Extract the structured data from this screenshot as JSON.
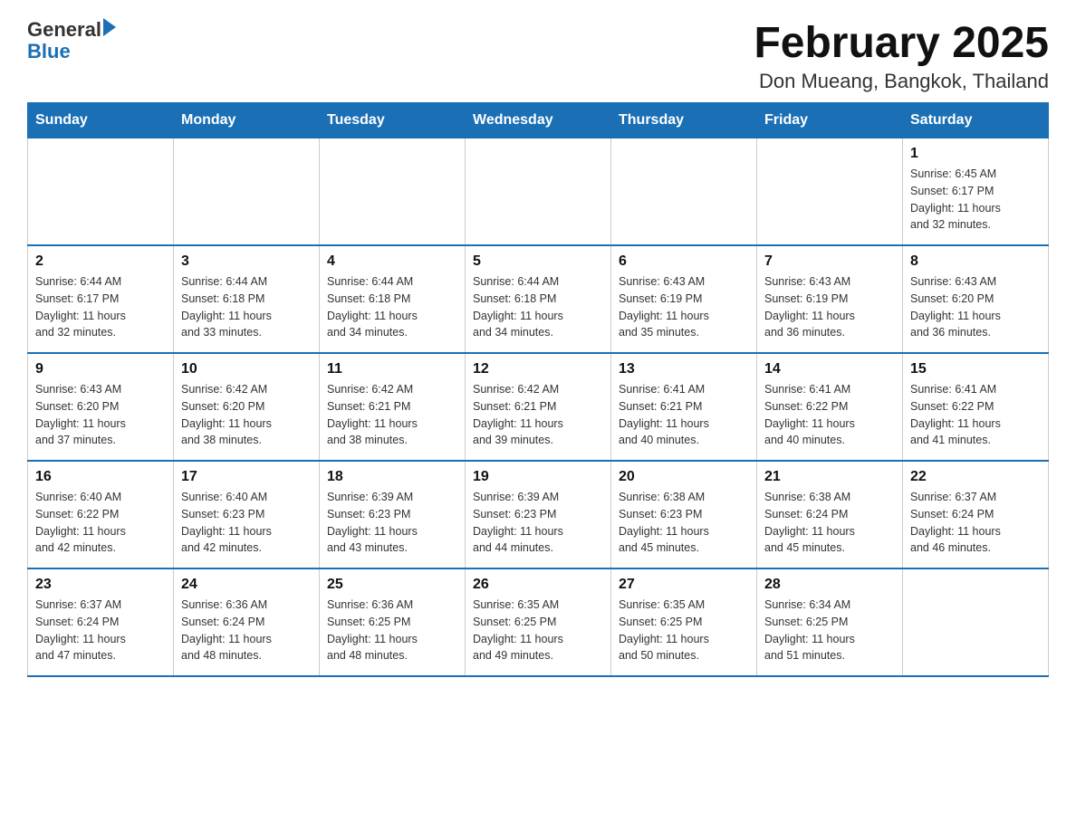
{
  "header": {
    "logo_general": "General",
    "logo_blue": "Blue",
    "month_title": "February 2025",
    "location": "Don Mueang, Bangkok, Thailand"
  },
  "days_of_week": [
    "Sunday",
    "Monday",
    "Tuesday",
    "Wednesday",
    "Thursday",
    "Friday",
    "Saturday"
  ],
  "weeks": [
    {
      "days": [
        {
          "number": "",
          "info": ""
        },
        {
          "number": "",
          "info": ""
        },
        {
          "number": "",
          "info": ""
        },
        {
          "number": "",
          "info": ""
        },
        {
          "number": "",
          "info": ""
        },
        {
          "number": "",
          "info": ""
        },
        {
          "number": "1",
          "info": "Sunrise: 6:45 AM\nSunset: 6:17 PM\nDaylight: 11 hours\nand 32 minutes."
        }
      ]
    },
    {
      "days": [
        {
          "number": "2",
          "info": "Sunrise: 6:44 AM\nSunset: 6:17 PM\nDaylight: 11 hours\nand 32 minutes."
        },
        {
          "number": "3",
          "info": "Sunrise: 6:44 AM\nSunset: 6:18 PM\nDaylight: 11 hours\nand 33 minutes."
        },
        {
          "number": "4",
          "info": "Sunrise: 6:44 AM\nSunset: 6:18 PM\nDaylight: 11 hours\nand 34 minutes."
        },
        {
          "number": "5",
          "info": "Sunrise: 6:44 AM\nSunset: 6:18 PM\nDaylight: 11 hours\nand 34 minutes."
        },
        {
          "number": "6",
          "info": "Sunrise: 6:43 AM\nSunset: 6:19 PM\nDaylight: 11 hours\nand 35 minutes."
        },
        {
          "number": "7",
          "info": "Sunrise: 6:43 AM\nSunset: 6:19 PM\nDaylight: 11 hours\nand 36 minutes."
        },
        {
          "number": "8",
          "info": "Sunrise: 6:43 AM\nSunset: 6:20 PM\nDaylight: 11 hours\nand 36 minutes."
        }
      ]
    },
    {
      "days": [
        {
          "number": "9",
          "info": "Sunrise: 6:43 AM\nSunset: 6:20 PM\nDaylight: 11 hours\nand 37 minutes."
        },
        {
          "number": "10",
          "info": "Sunrise: 6:42 AM\nSunset: 6:20 PM\nDaylight: 11 hours\nand 38 minutes."
        },
        {
          "number": "11",
          "info": "Sunrise: 6:42 AM\nSunset: 6:21 PM\nDaylight: 11 hours\nand 38 minutes."
        },
        {
          "number": "12",
          "info": "Sunrise: 6:42 AM\nSunset: 6:21 PM\nDaylight: 11 hours\nand 39 minutes."
        },
        {
          "number": "13",
          "info": "Sunrise: 6:41 AM\nSunset: 6:21 PM\nDaylight: 11 hours\nand 40 minutes."
        },
        {
          "number": "14",
          "info": "Sunrise: 6:41 AM\nSunset: 6:22 PM\nDaylight: 11 hours\nand 40 minutes."
        },
        {
          "number": "15",
          "info": "Sunrise: 6:41 AM\nSunset: 6:22 PM\nDaylight: 11 hours\nand 41 minutes."
        }
      ]
    },
    {
      "days": [
        {
          "number": "16",
          "info": "Sunrise: 6:40 AM\nSunset: 6:22 PM\nDaylight: 11 hours\nand 42 minutes."
        },
        {
          "number": "17",
          "info": "Sunrise: 6:40 AM\nSunset: 6:23 PM\nDaylight: 11 hours\nand 42 minutes."
        },
        {
          "number": "18",
          "info": "Sunrise: 6:39 AM\nSunset: 6:23 PM\nDaylight: 11 hours\nand 43 minutes."
        },
        {
          "number": "19",
          "info": "Sunrise: 6:39 AM\nSunset: 6:23 PM\nDaylight: 11 hours\nand 44 minutes."
        },
        {
          "number": "20",
          "info": "Sunrise: 6:38 AM\nSunset: 6:23 PM\nDaylight: 11 hours\nand 45 minutes."
        },
        {
          "number": "21",
          "info": "Sunrise: 6:38 AM\nSunset: 6:24 PM\nDaylight: 11 hours\nand 45 minutes."
        },
        {
          "number": "22",
          "info": "Sunrise: 6:37 AM\nSunset: 6:24 PM\nDaylight: 11 hours\nand 46 minutes."
        }
      ]
    },
    {
      "days": [
        {
          "number": "23",
          "info": "Sunrise: 6:37 AM\nSunset: 6:24 PM\nDaylight: 11 hours\nand 47 minutes."
        },
        {
          "number": "24",
          "info": "Sunrise: 6:36 AM\nSunset: 6:24 PM\nDaylight: 11 hours\nand 48 minutes."
        },
        {
          "number": "25",
          "info": "Sunrise: 6:36 AM\nSunset: 6:25 PM\nDaylight: 11 hours\nand 48 minutes."
        },
        {
          "number": "26",
          "info": "Sunrise: 6:35 AM\nSunset: 6:25 PM\nDaylight: 11 hours\nand 49 minutes."
        },
        {
          "number": "27",
          "info": "Sunrise: 6:35 AM\nSunset: 6:25 PM\nDaylight: 11 hours\nand 50 minutes."
        },
        {
          "number": "28",
          "info": "Sunrise: 6:34 AM\nSunset: 6:25 PM\nDaylight: 11 hours\nand 51 minutes."
        },
        {
          "number": "",
          "info": ""
        }
      ]
    }
  ]
}
